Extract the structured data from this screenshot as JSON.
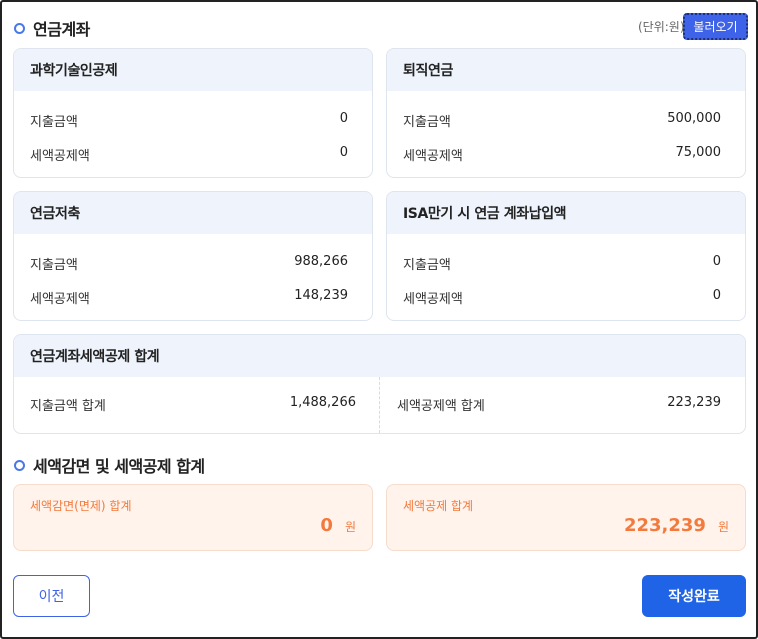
{
  "header": {
    "title": "연금계좌",
    "unit": "(단위:원)",
    "load_button": "불러오기"
  },
  "cards": {
    "science": {
      "title": "과학기술인공제",
      "rows": [
        {
          "label": "지출금액",
          "value": "0"
        },
        {
          "label": "세액공제액",
          "value": "0"
        }
      ]
    },
    "retirement": {
      "title": "퇴직연금",
      "rows": [
        {
          "label": "지출금액",
          "value": "500,000"
        },
        {
          "label": "세액공제액",
          "value": "75,000"
        }
      ]
    },
    "savings": {
      "title": "연금저축",
      "rows": [
        {
          "label": "지출금액",
          "value": "988,266"
        },
        {
          "label": "세액공제액",
          "value": "148,239"
        }
      ]
    },
    "isa": {
      "title": "ISA만기 시 연금 계좌납입액",
      "rows": [
        {
          "label": "지출금액",
          "value": "0"
        },
        {
          "label": "세액공제액",
          "value": "0"
        }
      ]
    },
    "total": {
      "title": "연금계좌세액공제 합계",
      "left": {
        "label": "지출금액 합계",
        "value": "1,488,266"
      },
      "right": {
        "label": "세액공제액 합계",
        "value": "223,239"
      }
    }
  },
  "section2": {
    "title": "세액감면 및 세액공제 합계",
    "reduction": {
      "label": "세액감면(면제) 합계",
      "value": "0",
      "unit": "원"
    },
    "credit": {
      "label": "세액공제 합계",
      "value": "223,239",
      "unit": "원"
    }
  },
  "footer": {
    "prev_button": "이전",
    "done_button": "작성완료"
  },
  "colors": {
    "accent": "#3f63e8",
    "primary_button": "#1f63e6",
    "card_header_bg": "#eef3fc",
    "tax_card_bg": "#fff3ec",
    "tax_text": "#f27a3c"
  },
  "icons": {
    "section_bullet": "circle-bullet-icon"
  }
}
